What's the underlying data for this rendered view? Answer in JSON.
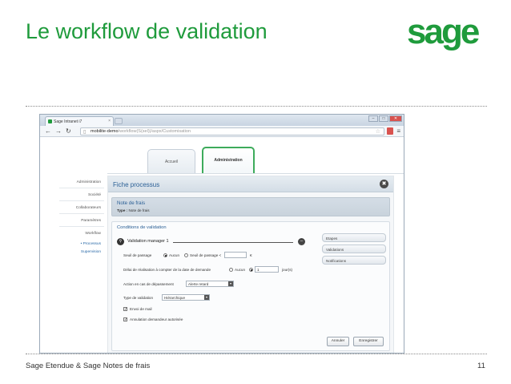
{
  "slide": {
    "title": "Le workflow de validation",
    "logo": "sage",
    "footer": "Sage Etendue & Sage Notes de frais",
    "page_number": "11"
  },
  "browser": {
    "tab_title": "Sage Intranet i7",
    "tab_close": "×",
    "url_host": "mobilite-demo",
    "url_path": "/workflow(S(sel))/aspx/Customisation",
    "win_controls": [
      "–",
      "□",
      "✕"
    ]
  },
  "app": {
    "tabs": [
      "Accueil",
      "Administration"
    ],
    "active_tab": "Administration",
    "sidebar": {
      "items": [
        "Administration",
        "Société",
        "Collaborateurs",
        "Paramètres",
        "Workflow"
      ],
      "sub_items": [
        "Processus",
        "Supervision"
      ]
    },
    "panel": {
      "title": "Fiche processus",
      "close": "✖",
      "note_title": "Note de frais",
      "type_label": "Type :",
      "type_value": "Note de frais",
      "conditions_title": "Conditions de validation",
      "manager_label": "Validation manager 1",
      "seuil_label": "Seuil de passage",
      "seuil_opt_aucun": "Aucun",
      "seuil_opt_seuil": "Seuil de passage <",
      "seuil_value": "",
      "seuil_unit": "€",
      "delai_label": "Délai de réalisation à compter de la date de demande",
      "delai_opt_aucun": "Aucun",
      "delai_value": "1",
      "delai_unit": "jour(s)",
      "action_label": "Action en cas de dépassement",
      "action_value": "Alerte retard",
      "type_validation_label": "Type de validation",
      "type_validation_value": "Hiérarchique",
      "envoi_mail_label": "Envoi de mail",
      "annulation_label": "Annulation demandeur autorisée",
      "side_buttons": [
        "Etapes",
        "Validations",
        "Notifications"
      ],
      "cancel_button": "Annuler",
      "save_button": "Enregistrer"
    }
  }
}
